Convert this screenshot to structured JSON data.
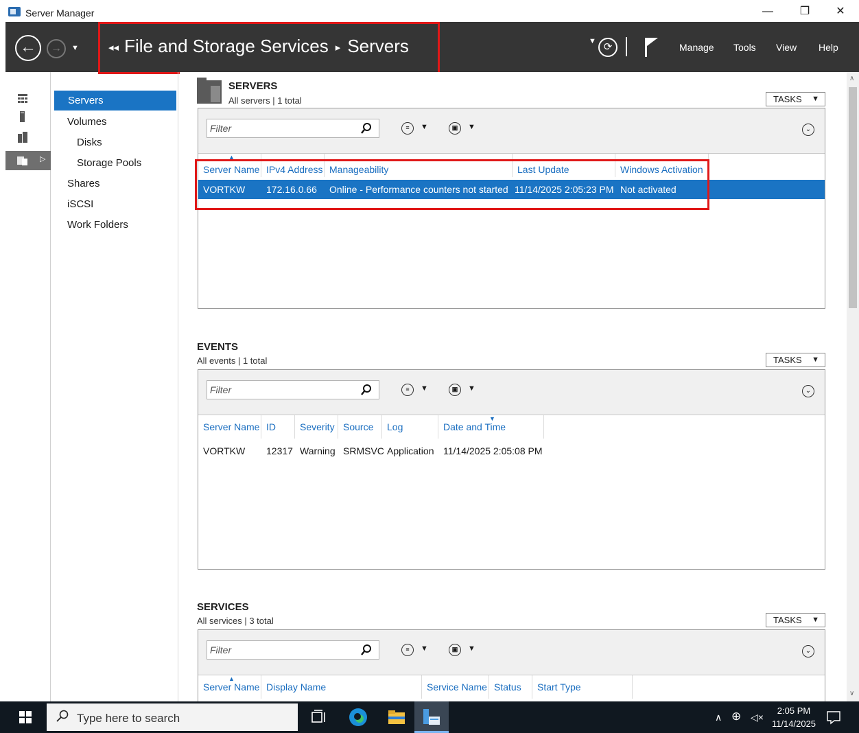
{
  "window": {
    "title": "Server Manager",
    "controls": {
      "minimize": "—",
      "restore": "❐",
      "close": "✕"
    }
  },
  "navbar": {
    "breadcrumb": {
      "lead": "◂◂",
      "parent": "File and Storage Services",
      "sep": "▸",
      "current": "Servers"
    },
    "menu": {
      "manage": "Manage",
      "tools": "Tools",
      "view": "View",
      "help": "Help"
    }
  },
  "sidebar": {
    "items": [
      {
        "label": "Servers",
        "active": true
      },
      {
        "label": "Volumes"
      },
      {
        "label": "Disks",
        "sub": true
      },
      {
        "label": "Storage Pools",
        "sub": true
      },
      {
        "label": "Shares"
      },
      {
        "label": "iSCSI"
      },
      {
        "label": "Work Folders"
      }
    ]
  },
  "servers": {
    "title": "SERVERS",
    "subtitle": "All servers | 1 total",
    "tasks": "TASKS",
    "filter_placeholder": "Filter",
    "columns": [
      "Server Name",
      "IPv4 Address",
      "Manageability",
      "Last Update",
      "Windows Activation"
    ],
    "rows": [
      {
        "name": "VORTKW",
        "ip": "172.16.0.66",
        "manageability": "Online - Performance counters not started",
        "last_update": "11/14/2025 2:05:23 PM",
        "activation": "Not activated"
      }
    ]
  },
  "events": {
    "title": "EVENTS",
    "subtitle": "All events | 1 total",
    "tasks": "TASKS",
    "filter_placeholder": "Filter",
    "columns": [
      "Server Name",
      "ID",
      "Severity",
      "Source",
      "Log",
      "Date and Time"
    ],
    "rows": [
      {
        "name": "VORTKW",
        "id": "12317",
        "severity": "Warning",
        "source": "SRMSVC",
        "log": "Application",
        "datetime": "11/14/2025 2:05:08 PM"
      }
    ]
  },
  "services": {
    "title": "SERVICES",
    "subtitle": "All services | 3 total",
    "tasks": "TASKS",
    "filter_placeholder": "Filter",
    "columns": [
      "Server Name",
      "Display Name",
      "Service Name",
      "Status",
      "Start Type"
    ]
  },
  "taskbar": {
    "search_placeholder": "Type here to search",
    "time": "2:05 PM",
    "date": "11/14/2025"
  },
  "colors": {
    "accent": "#1a74c4",
    "navbar": "#353535",
    "highlight": "#e01818"
  }
}
